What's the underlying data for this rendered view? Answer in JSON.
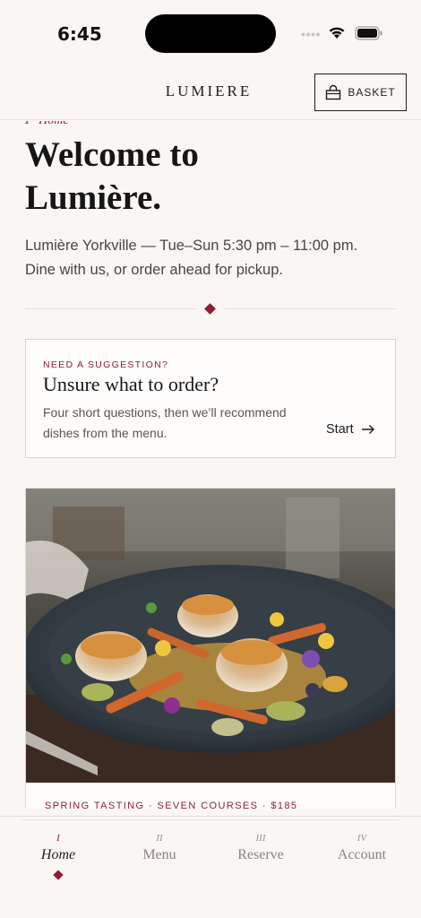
{
  "status": {
    "time": "6:45"
  },
  "header": {
    "brand": "LUMIERE",
    "basket_label": "BASKET"
  },
  "breadcrumb": "I · Home",
  "hero": {
    "title_line1": "Welcome to",
    "title_line2": "Lumière.",
    "intro": "Lumière Yorkville — Tue–Sun  5:30 pm – 11:00 pm. Dine with us, or order ahead for pickup."
  },
  "suggestion": {
    "eyebrow": "NEED A SUGGESTION?",
    "title": "Unsure what to order?",
    "body": "Four short questions, then we’ll recommend dishes from the menu.",
    "cta": "Start"
  },
  "feature": {
    "meta": "SPRING TASTING  ·  SEVEN COURSES  ·  $185"
  },
  "tabs": [
    {
      "numeral": "I",
      "label": "Home"
    },
    {
      "numeral": "II",
      "label": "Menu"
    },
    {
      "numeral": "III",
      "label": "Reserve"
    },
    {
      "numeral": "IV",
      "label": "Account"
    }
  ],
  "colors": {
    "accent": "#8f1d34",
    "background": "#faf6f4",
    "text": "#161616"
  },
  "icons": [
    "cellular-signal-icon",
    "wifi-icon",
    "battery-icon",
    "shopping-bag-icon",
    "arrow-right-icon",
    "diamond-ornament-icon"
  ]
}
